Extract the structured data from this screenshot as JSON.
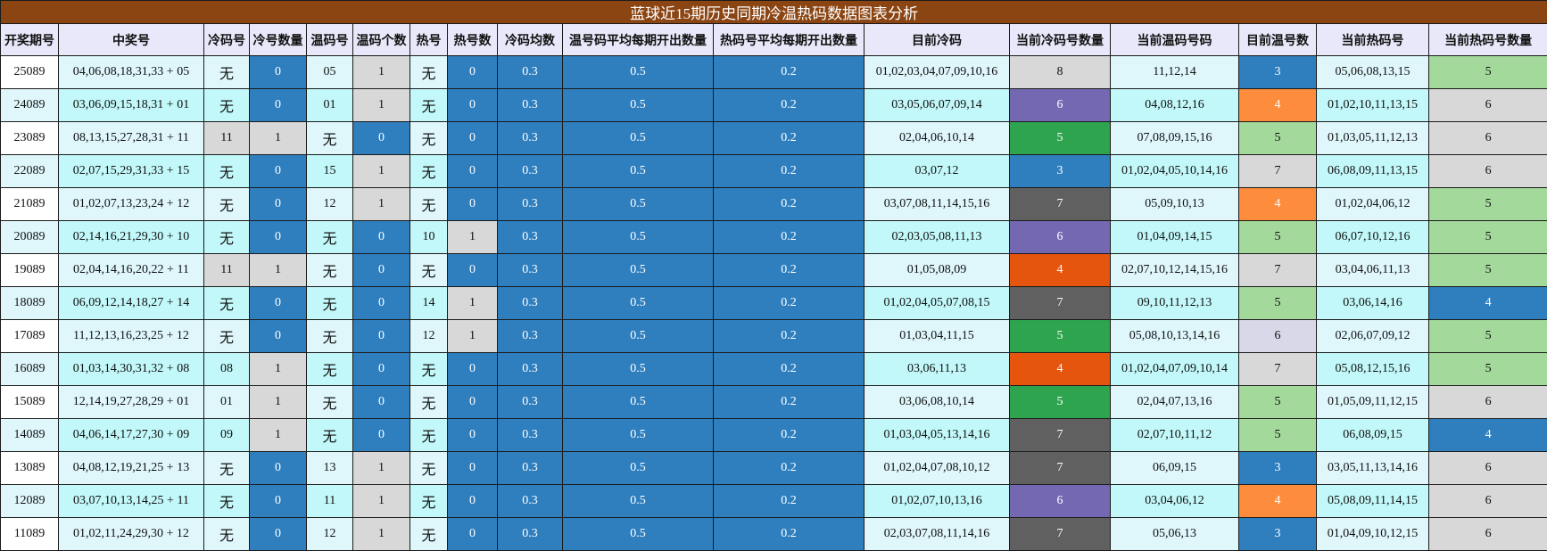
{
  "title": "蓝球近15期历史同期冷温热码数据图表分析",
  "headers": [
    "开奖期号",
    "中奖号",
    "冷码号",
    "冷号数量",
    "温码号",
    "温码个数",
    "热号",
    "热号数",
    "冷码均数",
    "温号码平均每期开出数量",
    "热码号平均每期开出数量",
    "目前冷码",
    "当前冷码号数量",
    "当前温码号码",
    "目前温号数",
    "当前热码号",
    "当前热码号数量"
  ],
  "rows": [
    [
      "25089",
      "04,06,08,18,31,33 + 05",
      "无",
      "0",
      "05",
      "1",
      "无",
      "0",
      "0.3",
      "0.5",
      "0.2",
      "01,02,03,04,07,09,10,16",
      "8",
      "11,12,14",
      "3",
      "05,06,08,13,15",
      "5"
    ],
    [
      "24089",
      "03,06,09,15,18,31 + 01",
      "无",
      "0",
      "01",
      "1",
      "无",
      "0",
      "0.3",
      "0.5",
      "0.2",
      "03,05,06,07,09,14",
      "6",
      "04,08,12,16",
      "4",
      "01,02,10,11,13,15",
      "6"
    ],
    [
      "23089",
      "08,13,15,27,28,31 + 11",
      "11",
      "1",
      "无",
      "0",
      "无",
      "0",
      "0.3",
      "0.5",
      "0.2",
      "02,04,06,10,14",
      "5",
      "07,08,09,15,16",
      "5",
      "01,03,05,11,12,13",
      "6"
    ],
    [
      "22089",
      "02,07,15,29,31,33 + 15",
      "无",
      "0",
      "15",
      "1",
      "无",
      "0",
      "0.3",
      "0.5",
      "0.2",
      "03,07,12",
      "3",
      "01,02,04,05,10,14,16",
      "7",
      "06,08,09,11,13,15",
      "6"
    ],
    [
      "21089",
      "01,02,07,13,23,24 + 12",
      "无",
      "0",
      "12",
      "1",
      "无",
      "0",
      "0.3",
      "0.5",
      "0.2",
      "03,07,08,11,14,15,16",
      "7",
      "05,09,10,13",
      "4",
      "01,02,04,06,12",
      "5"
    ],
    [
      "20089",
      "02,14,16,21,29,30 + 10",
      "无",
      "0",
      "无",
      "0",
      "10",
      "1",
      "0.3",
      "0.5",
      "0.2",
      "02,03,05,08,11,13",
      "6",
      "01,04,09,14,15",
      "5",
      "06,07,10,12,16",
      "5"
    ],
    [
      "19089",
      "02,04,14,16,20,22 + 11",
      "11",
      "1",
      "无",
      "0",
      "无",
      "0",
      "0.3",
      "0.5",
      "0.2",
      "01,05,08,09",
      "4",
      "02,07,10,12,14,15,16",
      "7",
      "03,04,06,11,13",
      "5"
    ],
    [
      "18089",
      "06,09,12,14,18,27 + 14",
      "无",
      "0",
      "无",
      "0",
      "14",
      "1",
      "0.3",
      "0.5",
      "0.2",
      "01,02,04,05,07,08,15",
      "7",
      "09,10,11,12,13",
      "5",
      "03,06,14,16",
      "4"
    ],
    [
      "17089",
      "11,12,13,16,23,25 + 12",
      "无",
      "0",
      "无",
      "0",
      "12",
      "1",
      "0.3",
      "0.5",
      "0.2",
      "01,03,04,11,15",
      "5",
      "05,08,10,13,14,16",
      "6",
      "02,06,07,09,12",
      "5"
    ],
    [
      "16089",
      "01,03,14,30,31,32 + 08",
      "08",
      "1",
      "无",
      "0",
      "无",
      "0",
      "0.3",
      "0.5",
      "0.2",
      "03,06,11,13",
      "4",
      "01,02,04,07,09,10,14",
      "7",
      "05,08,12,15,16",
      "5"
    ],
    [
      "15089",
      "12,14,19,27,28,29 + 01",
      "01",
      "1",
      "无",
      "0",
      "无",
      "0",
      "0.3",
      "0.5",
      "0.2",
      "03,06,08,10,14",
      "5",
      "02,04,07,13,16",
      "5",
      "01,05,09,11,12,15",
      "6"
    ],
    [
      "14089",
      "04,06,14,17,27,30 + 09",
      "09",
      "1",
      "无",
      "0",
      "无",
      "0",
      "0.3",
      "0.5",
      "0.2",
      "01,03,04,05,13,14,16",
      "7",
      "02,07,10,11,12",
      "5",
      "06,08,09,15",
      "4"
    ],
    [
      "13089",
      "04,08,12,19,21,25 + 13",
      "无",
      "0",
      "13",
      "1",
      "无",
      "0",
      "0.3",
      "0.5",
      "0.2",
      "01,02,04,07,08,10,12",
      "7",
      "06,09,15",
      "3",
      "03,05,11,13,14,16",
      "6"
    ],
    [
      "12089",
      "03,07,10,13,14,25 + 11",
      "无",
      "0",
      "11",
      "1",
      "无",
      "0",
      "0.3",
      "0.5",
      "0.2",
      "01,02,07,10,13,16",
      "6",
      "03,04,06,12",
      "4",
      "05,08,09,11,14,15",
      "6"
    ],
    [
      "11089",
      "01,02,11,24,29,30 + 12",
      "无",
      "0",
      "12",
      "1",
      "无",
      "0",
      "0.3",
      "0.5",
      "0.2",
      "02,03,07,08,11,14,16",
      "7",
      "05,06,13",
      "3",
      "01,04,09,10,12,15",
      "6"
    ]
  ],
  "cell_colors": [
    [
      "white",
      "light",
      "light",
      "blue",
      "light",
      "gray",
      "light",
      "blue",
      "blue",
      "blue",
      "blue",
      "light",
      "gray",
      "light",
      "blue",
      "light",
      "lightgreen"
    ],
    [
      "light",
      "cyan",
      "cyan",
      "blue",
      "cyan",
      "gray",
      "cyan",
      "blue",
      "blue",
      "blue",
      "blue",
      "cyan",
      "purple",
      "cyan",
      "orange",
      "cyan",
      "gray"
    ],
    [
      "white",
      "light",
      "gray",
      "gray",
      "light",
      "blue",
      "light",
      "blue",
      "blue",
      "blue",
      "blue",
      "light",
      "green",
      "light",
      "lightgreen",
      "light",
      "gray"
    ],
    [
      "light",
      "cyan",
      "cyan",
      "blue",
      "cyan",
      "gray",
      "cyan",
      "blue",
      "blue",
      "blue",
      "blue",
      "cyan",
      "blue",
      "cyan",
      "gray",
      "cyan",
      "gray"
    ],
    [
      "white",
      "light",
      "light",
      "blue",
      "light",
      "gray",
      "light",
      "blue",
      "blue",
      "blue",
      "blue",
      "light",
      "darkgray",
      "light",
      "orange",
      "light",
      "lightgreen"
    ],
    [
      "light",
      "cyan",
      "cyan",
      "blue",
      "cyan",
      "blue",
      "cyan",
      "gray",
      "blue",
      "blue",
      "blue",
      "cyan",
      "purple",
      "cyan",
      "lightgreen",
      "cyan",
      "lightgreen"
    ],
    [
      "white",
      "light",
      "gray",
      "gray",
      "light",
      "blue",
      "light",
      "blue",
      "blue",
      "blue",
      "blue",
      "light",
      "darkorange",
      "light",
      "gray",
      "light",
      "lightgreen"
    ],
    [
      "light",
      "cyan",
      "cyan",
      "blue",
      "cyan",
      "blue",
      "cyan",
      "gray",
      "blue",
      "blue",
      "blue",
      "cyan",
      "darkgray",
      "cyan",
      "lightgreen",
      "cyan",
      "blue"
    ],
    [
      "white",
      "light",
      "light",
      "blue",
      "light",
      "blue",
      "light",
      "gray",
      "blue",
      "blue",
      "blue",
      "light",
      "green",
      "light",
      "lavender",
      "light",
      "lightgreen"
    ],
    [
      "light",
      "cyan",
      "cyan",
      "gray",
      "cyan",
      "blue",
      "cyan",
      "blue",
      "blue",
      "blue",
      "blue",
      "cyan",
      "darkorange",
      "cyan",
      "gray",
      "cyan",
      "lightgreen"
    ],
    [
      "white",
      "light",
      "light",
      "gray",
      "light",
      "blue",
      "light",
      "blue",
      "blue",
      "blue",
      "blue",
      "light",
      "green",
      "light",
      "lightgreen",
      "light",
      "gray"
    ],
    [
      "light",
      "cyan",
      "cyan",
      "gray",
      "cyan",
      "blue",
      "cyan",
      "blue",
      "blue",
      "blue",
      "blue",
      "cyan",
      "darkgray",
      "cyan",
      "lightgreen",
      "cyan",
      "blue"
    ],
    [
      "white",
      "light",
      "light",
      "blue",
      "light",
      "gray",
      "light",
      "blue",
      "blue",
      "blue",
      "blue",
      "light",
      "darkgray",
      "light",
      "blue",
      "light",
      "gray"
    ],
    [
      "light",
      "cyan",
      "cyan",
      "blue",
      "cyan",
      "gray",
      "cyan",
      "blue",
      "blue",
      "blue",
      "blue",
      "cyan",
      "purple",
      "cyan",
      "orange",
      "cyan",
      "gray"
    ],
    [
      "white",
      "light",
      "light",
      "blue",
      "light",
      "gray",
      "light",
      "blue",
      "blue",
      "blue",
      "blue",
      "light",
      "darkgray",
      "light",
      "blue",
      "light",
      "gray"
    ]
  ]
}
